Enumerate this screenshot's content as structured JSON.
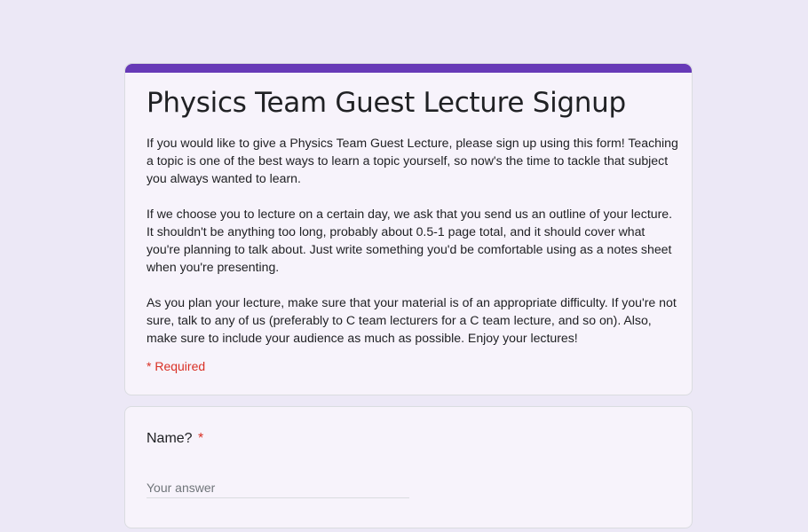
{
  "form": {
    "title": "Physics Team Guest Lecture Signup",
    "description": [
      "If you would like to give a Physics Team Guest Lecture, please sign up using this form! Teaching a topic is one of the best ways to learn a topic yourself, so now's the time to tackle that subject you always wanted to learn.",
      "If we choose you to lecture on a certain day, we ask that you send us an outline of your lecture. It shouldn't be anything too long, probably about 0.5-1 page total, and it should cover what you're planning to talk about. Just write something you'd be comfortable using as a notes sheet when you're presenting.",
      "As you plan your lecture, make sure that your material is of an appropriate difficulty. If you're not sure, talk to any of us (preferably to C team lecturers for a C team lecture, and so on). Also, make sure to include your audience as much as possible. Enjoy your lectures!"
    ],
    "required_note": "* Required",
    "accent_color": "#673ab7",
    "required_color": "#d93025"
  },
  "questions": [
    {
      "label": "Name?",
      "required_mark": "*",
      "value": "",
      "placeholder": "Your answer"
    }
  ]
}
